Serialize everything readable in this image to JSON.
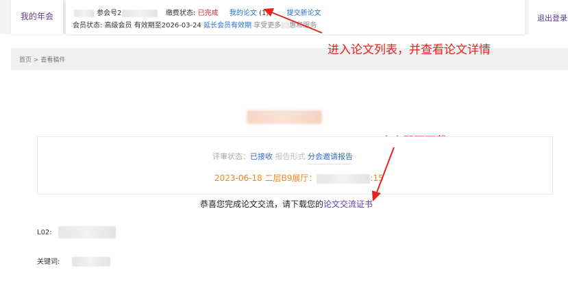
{
  "header": {
    "my_annual": "我的年会",
    "logout": "退出登录",
    "member_no_label": "参会号2",
    "payment_status_label": "缴费状态:",
    "payment_status_value": "已完成",
    "my_papers_link": "我的论文",
    "my_papers_count": "(1)",
    "submit_new_link": "提交新论文",
    "member_status_label": "会员状态:",
    "member_level": "高级会员",
    "valid_until_label": "有效期至",
    "valid_until_date": "2026-03-24",
    "extend_link": "延长会员有效期",
    "benefit_prefix": "享受更多",
    "benefit_suffix": "惠和服务"
  },
  "breadcrumb": {
    "home": "首页",
    "separator": ">",
    "current": "查看稿件"
  },
  "annotations": {
    "enter_list": "进入论文列表，并查看论文详情",
    "click_download": "点击即可下载"
  },
  "review": {
    "status_label": "评审状态：",
    "status_value": "已接收",
    "report_form_label": "报告形式",
    "invite_report_link": "分会邀请报告",
    "date_prefix": "2023-06-18 二层B9展厅：",
    "date_suffix": ":15"
  },
  "congrats": {
    "text": "恭喜您完成论文交流，请下载您的",
    "certificate_link": "论文交流证书"
  },
  "fields": {
    "l02_label": "L02:",
    "keywords_label": "关键词:"
  },
  "colors": {
    "brand_purple": "#5b3b8c",
    "status_red": "#e02b2b",
    "link_blue": "#1f6fcf",
    "date_orange": "#f08519",
    "annotation_red": "#e8211e"
  }
}
